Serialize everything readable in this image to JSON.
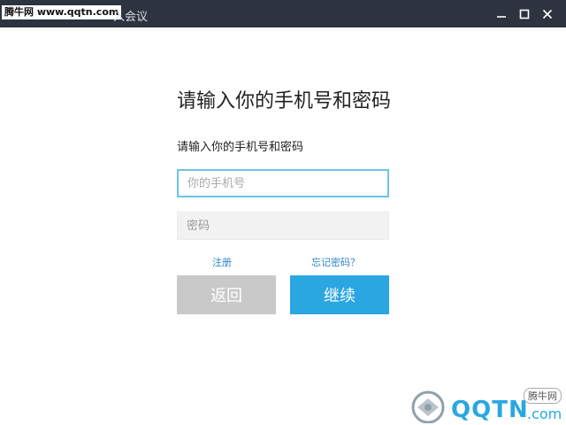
{
  "window": {
    "title": "入会议",
    "watermark_top": "腾牛网 www.qqtn.com",
    "controls": [
      "minimize",
      "maximize",
      "close"
    ]
  },
  "form": {
    "heading": "请输入你的手机号和密码",
    "subheading": "请输入你的手机号和密码",
    "phone_placeholder": "你的手机号",
    "phone_value": "",
    "password_placeholder": "密码",
    "password_value": "",
    "register_label": "注册",
    "forgot_label": "忘记密码？",
    "back_label": "返回",
    "continue_label": "继续"
  },
  "watermark_bottom": {
    "brand": "QQTN",
    "suffix": ".com",
    "badge": "腾牛网"
  },
  "colors": {
    "titlebar": "#2d3440",
    "accent": "#2aa7e0",
    "back_button": "#c9c9c9",
    "link": "#2b86c5"
  }
}
